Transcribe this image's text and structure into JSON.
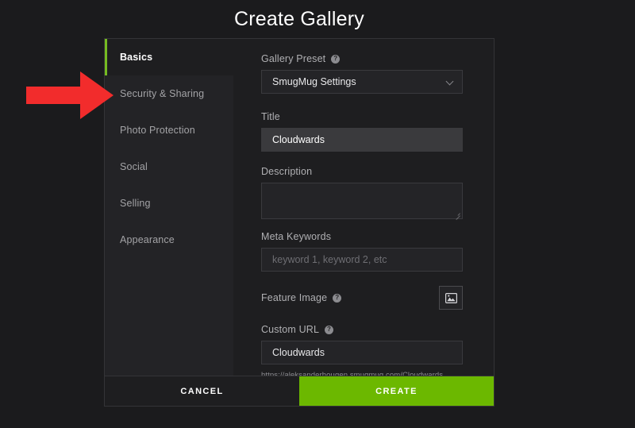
{
  "dialog": {
    "title": "Create Gallery"
  },
  "sidebar": {
    "items": [
      {
        "label": "Basics",
        "active": true
      },
      {
        "label": "Security & Sharing",
        "active": false
      },
      {
        "label": "Photo Protection",
        "active": false
      },
      {
        "label": "Social",
        "active": false
      },
      {
        "label": "Selling",
        "active": false
      },
      {
        "label": "Appearance",
        "active": false
      }
    ],
    "accent_color": "#76bc21"
  },
  "form": {
    "gallery_preset": {
      "label": "Gallery Preset",
      "help": "?",
      "value": "SmugMug Settings"
    },
    "title": {
      "label": "Title",
      "value": "Cloudwards",
      "placeholder": ""
    },
    "description": {
      "label": "Description",
      "value": "",
      "placeholder": ""
    },
    "meta_keywords": {
      "label": "Meta Keywords",
      "value": "",
      "placeholder": "keyword 1, keyword 2, etc"
    },
    "feature_image": {
      "label": "Feature Image",
      "help": "?",
      "icon": "picture-icon"
    },
    "custom_url": {
      "label": "Custom URL",
      "help": "?",
      "value": "Cloudwards",
      "hint": "https://aleksanderhougen.smugmug.com/Cloudwards"
    }
  },
  "footer": {
    "cancel_label": "CANCEL",
    "create_label": "CREATE",
    "create_color": "#6cb800"
  },
  "annotation": {
    "arrow_color": "#f22c2c",
    "points_to": "Security & Sharing"
  }
}
